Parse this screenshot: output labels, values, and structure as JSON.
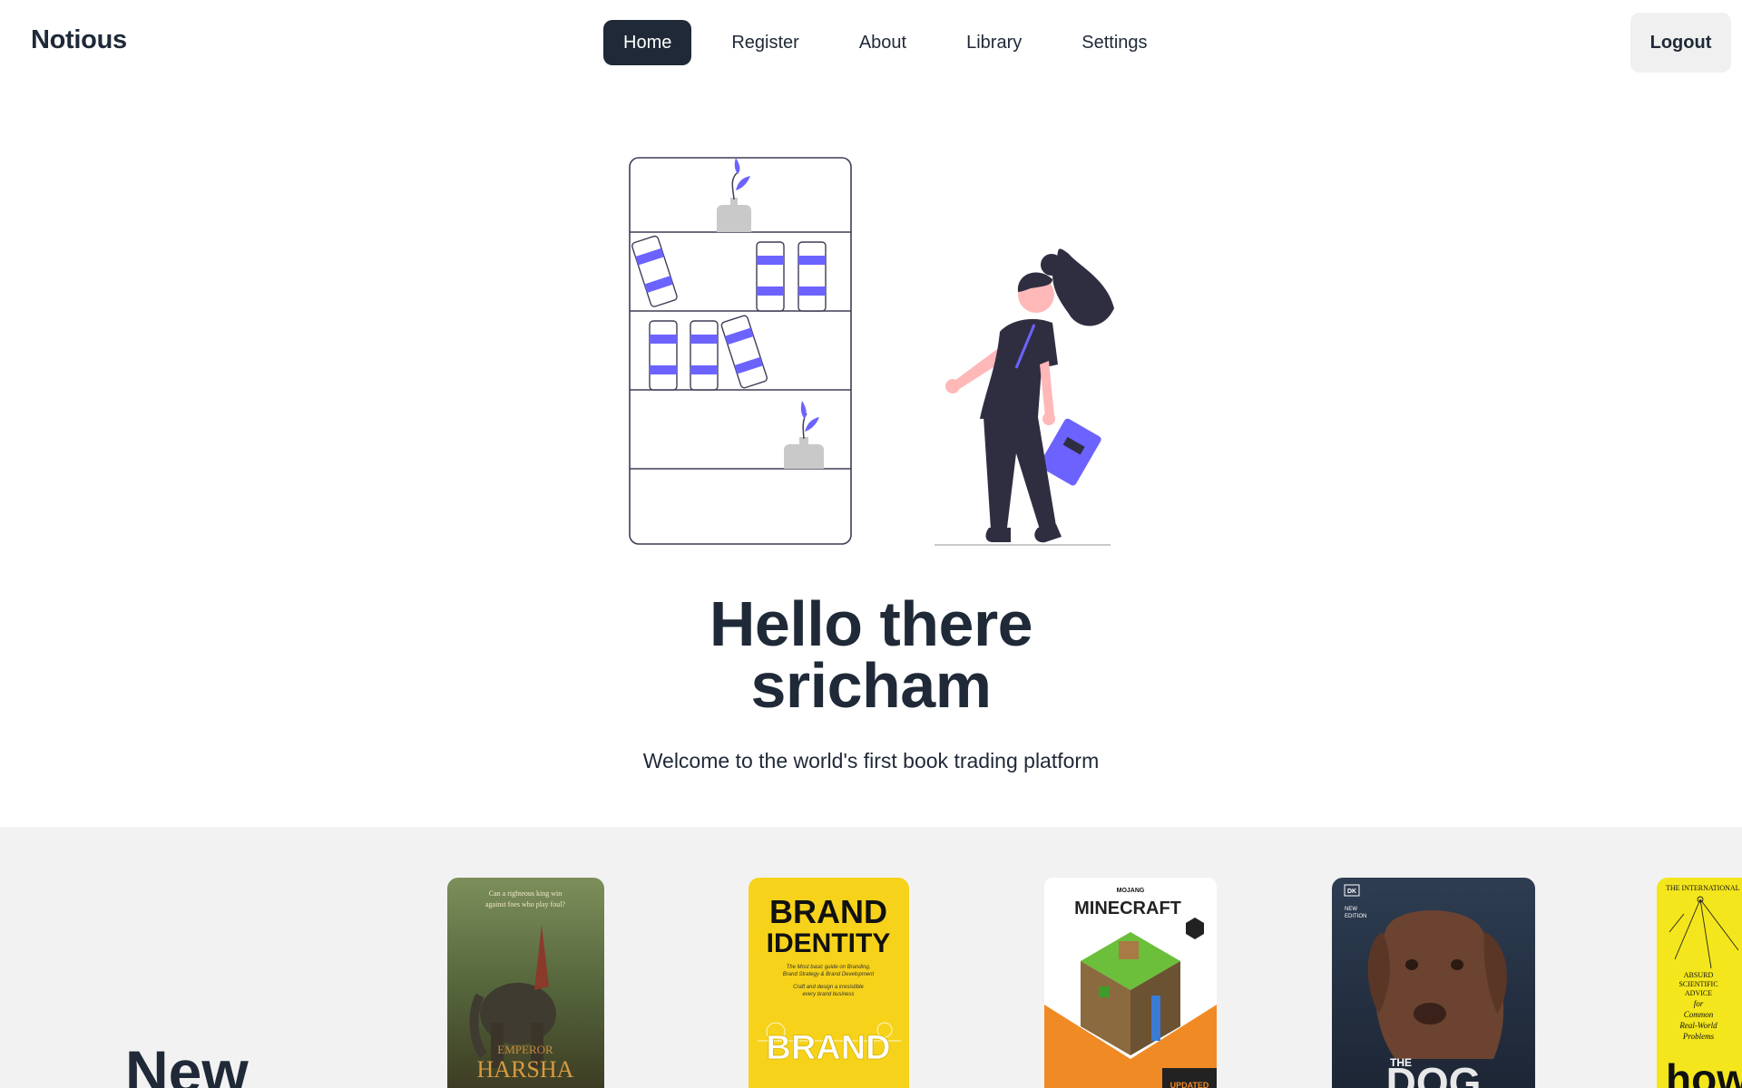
{
  "app": {
    "brand": "Notious"
  },
  "nav": {
    "items": [
      {
        "label": "Home",
        "active": true
      },
      {
        "label": "Register",
        "active": false
      },
      {
        "label": "About",
        "active": false
      },
      {
        "label": "Library",
        "active": false
      },
      {
        "label": "Settings",
        "active": false
      }
    ],
    "logout_label": "Logout"
  },
  "hero": {
    "title_line1": "Hello there",
    "title_line2": "sricham",
    "subtitle": "Welcome to the world's first book trading platform",
    "illustration": "person-with-bookshelf-illustration"
  },
  "new_section": {
    "heading": "New",
    "books": [
      {
        "cover_top": "Can a righteous king win against foes who play foul?",
        "title_small": "EMPEROR",
        "title_big": "HARSHA",
        "icon": "book-cover"
      },
      {
        "cover_line1": "BRAND",
        "cover_line2": "IDENTITY",
        "cover_tagline1": "The Most basic guide on Branding,",
        "cover_tagline2": "Brand Strategy & Brand Development",
        "cover_tagline3": "Craft and design a irresistible",
        "cover_tagline4": "every brand business",
        "cover_word": "BRAND",
        "icon": "book-cover"
      },
      {
        "publisher": "MOJANG",
        "title": "MINECRAFT",
        "badge": "UPDATED",
        "icon": "book-cover"
      },
      {
        "publisher": "DK",
        "edition_line1": "NEW",
        "edition_line2": "EDITION",
        "title_small": "THE",
        "title_big": "DOG",
        "icon": "book-cover"
      },
      {
        "top": "THE INTERNATIONAL",
        "line1": "ABSURD",
        "line2": "SCIENTIFIC",
        "line3": "ADVICE",
        "line4": "for",
        "line5": "Common",
        "line6": "Real-World",
        "line7": "Problems",
        "big": "how",
        "icon": "book-cover"
      }
    ]
  },
  "colors": {
    "dark": "#1f2937",
    "accent": "#6c63ff",
    "section_bg": "#f2f2f2"
  }
}
